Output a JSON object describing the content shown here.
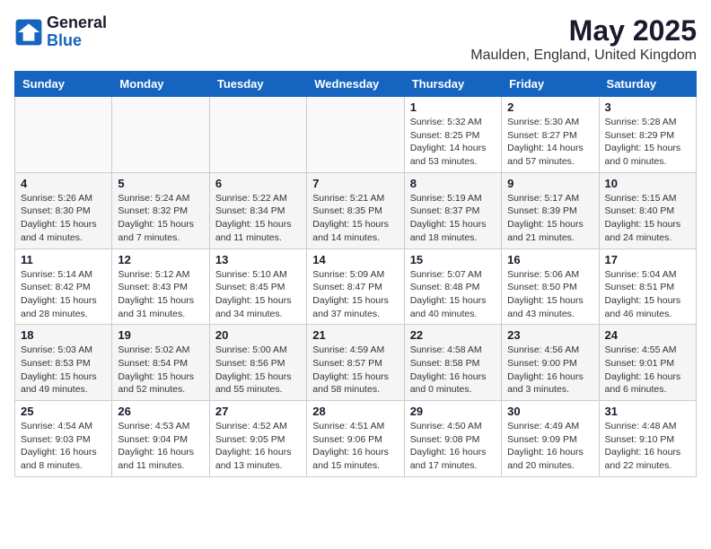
{
  "logo": {
    "general": "General",
    "blue": "Blue"
  },
  "title": "May 2025",
  "location": "Maulden, England, United Kingdom",
  "headers": [
    "Sunday",
    "Monday",
    "Tuesday",
    "Wednesday",
    "Thursday",
    "Friday",
    "Saturday"
  ],
  "weeks": [
    [
      {
        "day": "",
        "info": ""
      },
      {
        "day": "",
        "info": ""
      },
      {
        "day": "",
        "info": ""
      },
      {
        "day": "",
        "info": ""
      },
      {
        "day": "1",
        "info": "Sunrise: 5:32 AM\nSunset: 8:25 PM\nDaylight: 14 hours\nand 53 minutes."
      },
      {
        "day": "2",
        "info": "Sunrise: 5:30 AM\nSunset: 8:27 PM\nDaylight: 14 hours\nand 57 minutes."
      },
      {
        "day": "3",
        "info": "Sunrise: 5:28 AM\nSunset: 8:29 PM\nDaylight: 15 hours\nand 0 minutes."
      }
    ],
    [
      {
        "day": "4",
        "info": "Sunrise: 5:26 AM\nSunset: 8:30 PM\nDaylight: 15 hours\nand 4 minutes."
      },
      {
        "day": "5",
        "info": "Sunrise: 5:24 AM\nSunset: 8:32 PM\nDaylight: 15 hours\nand 7 minutes."
      },
      {
        "day": "6",
        "info": "Sunrise: 5:22 AM\nSunset: 8:34 PM\nDaylight: 15 hours\nand 11 minutes."
      },
      {
        "day": "7",
        "info": "Sunrise: 5:21 AM\nSunset: 8:35 PM\nDaylight: 15 hours\nand 14 minutes."
      },
      {
        "day": "8",
        "info": "Sunrise: 5:19 AM\nSunset: 8:37 PM\nDaylight: 15 hours\nand 18 minutes."
      },
      {
        "day": "9",
        "info": "Sunrise: 5:17 AM\nSunset: 8:39 PM\nDaylight: 15 hours\nand 21 minutes."
      },
      {
        "day": "10",
        "info": "Sunrise: 5:15 AM\nSunset: 8:40 PM\nDaylight: 15 hours\nand 24 minutes."
      }
    ],
    [
      {
        "day": "11",
        "info": "Sunrise: 5:14 AM\nSunset: 8:42 PM\nDaylight: 15 hours\nand 28 minutes."
      },
      {
        "day": "12",
        "info": "Sunrise: 5:12 AM\nSunset: 8:43 PM\nDaylight: 15 hours\nand 31 minutes."
      },
      {
        "day": "13",
        "info": "Sunrise: 5:10 AM\nSunset: 8:45 PM\nDaylight: 15 hours\nand 34 minutes."
      },
      {
        "day": "14",
        "info": "Sunrise: 5:09 AM\nSunset: 8:47 PM\nDaylight: 15 hours\nand 37 minutes."
      },
      {
        "day": "15",
        "info": "Sunrise: 5:07 AM\nSunset: 8:48 PM\nDaylight: 15 hours\nand 40 minutes."
      },
      {
        "day": "16",
        "info": "Sunrise: 5:06 AM\nSunset: 8:50 PM\nDaylight: 15 hours\nand 43 minutes."
      },
      {
        "day": "17",
        "info": "Sunrise: 5:04 AM\nSunset: 8:51 PM\nDaylight: 15 hours\nand 46 minutes."
      }
    ],
    [
      {
        "day": "18",
        "info": "Sunrise: 5:03 AM\nSunset: 8:53 PM\nDaylight: 15 hours\nand 49 minutes."
      },
      {
        "day": "19",
        "info": "Sunrise: 5:02 AM\nSunset: 8:54 PM\nDaylight: 15 hours\nand 52 minutes."
      },
      {
        "day": "20",
        "info": "Sunrise: 5:00 AM\nSunset: 8:56 PM\nDaylight: 15 hours\nand 55 minutes."
      },
      {
        "day": "21",
        "info": "Sunrise: 4:59 AM\nSunset: 8:57 PM\nDaylight: 15 hours\nand 58 minutes."
      },
      {
        "day": "22",
        "info": "Sunrise: 4:58 AM\nSunset: 8:58 PM\nDaylight: 16 hours\nand 0 minutes."
      },
      {
        "day": "23",
        "info": "Sunrise: 4:56 AM\nSunset: 9:00 PM\nDaylight: 16 hours\nand 3 minutes."
      },
      {
        "day": "24",
        "info": "Sunrise: 4:55 AM\nSunset: 9:01 PM\nDaylight: 16 hours\nand 6 minutes."
      }
    ],
    [
      {
        "day": "25",
        "info": "Sunrise: 4:54 AM\nSunset: 9:03 PM\nDaylight: 16 hours\nand 8 minutes."
      },
      {
        "day": "26",
        "info": "Sunrise: 4:53 AM\nSunset: 9:04 PM\nDaylight: 16 hours\nand 11 minutes."
      },
      {
        "day": "27",
        "info": "Sunrise: 4:52 AM\nSunset: 9:05 PM\nDaylight: 16 hours\nand 13 minutes."
      },
      {
        "day": "28",
        "info": "Sunrise: 4:51 AM\nSunset: 9:06 PM\nDaylight: 16 hours\nand 15 minutes."
      },
      {
        "day": "29",
        "info": "Sunrise: 4:50 AM\nSunset: 9:08 PM\nDaylight: 16 hours\nand 17 minutes."
      },
      {
        "day": "30",
        "info": "Sunrise: 4:49 AM\nSunset: 9:09 PM\nDaylight: 16 hours\nand 20 minutes."
      },
      {
        "day": "31",
        "info": "Sunrise: 4:48 AM\nSunset: 9:10 PM\nDaylight: 16 hours\nand 22 minutes."
      }
    ]
  ]
}
